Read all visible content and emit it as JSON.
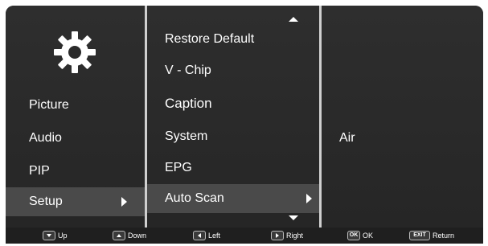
{
  "menu": {
    "icon": "gear-icon",
    "categories": [
      {
        "label": "Picture"
      },
      {
        "label": "Audio"
      },
      {
        "label": "PIP"
      },
      {
        "label": "Setup",
        "selected": true
      }
    ],
    "setup_items": [
      {
        "label": "Restore Default"
      },
      {
        "label": "V - Chip"
      },
      {
        "label": "Caption"
      },
      {
        "label": "System"
      },
      {
        "label": "EPG"
      },
      {
        "label": "Auto Scan",
        "selected": true
      }
    ],
    "detail": {
      "value": "Air"
    }
  },
  "footer": {
    "up": {
      "label": "Up"
    },
    "down": {
      "label": "Down"
    },
    "left": {
      "label": "Left"
    },
    "right": {
      "label": "Right"
    },
    "ok": {
      "key": "OK",
      "label": "OK"
    },
    "exit": {
      "key": "EXIT",
      "label": "Return"
    }
  },
  "colors": {
    "panel": "#2b2b2b",
    "selection": "#4a4a4a",
    "divider": "#cfcfcf",
    "text": "#ffffff"
  }
}
